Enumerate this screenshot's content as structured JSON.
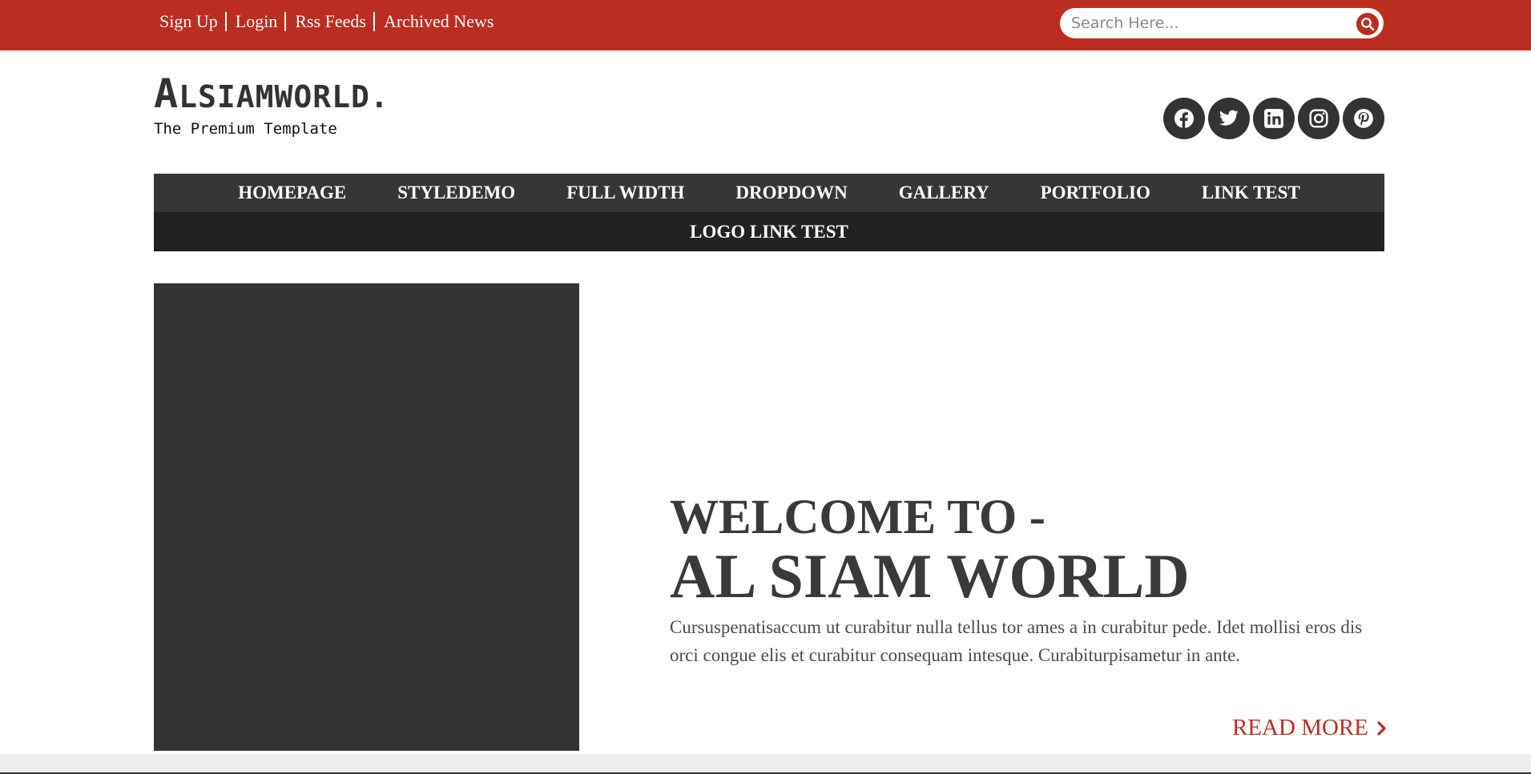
{
  "topbar": {
    "links": [
      "Sign Up",
      "Login",
      "Rss Feeds",
      "Archived News"
    ],
    "search_placeholder": "Search Here...",
    "search_icon": "search-icon"
  },
  "brand": {
    "title_cap": "A",
    "title_rest": "LSIAMWORLD.",
    "tagline": "The Premium Template"
  },
  "social": [
    "facebook-icon",
    "twitter-icon",
    "linkedin-icon",
    "instagram-icon",
    "pinterest-icon"
  ],
  "nav": {
    "items": [
      "HOMEPAGE",
      "STYLEDEMO",
      "FULL WIDTH",
      "DROPDOWN",
      "GALLERY",
      "PORTFOLIO",
      "LINK TEST",
      "LOGO LINK TEST"
    ]
  },
  "hero": {
    "line1": "WELCOME TO -",
    "line2": "AL SIAM WORLD",
    "body": "Cursuspenatisaccum ut curabitur nulla tellus tor ames a in curabitur pede. Idet mollisi eros dis orci congue elis et curabitur consequam intesque. Curabiturpisametur in ante.",
    "read_more": "READ MORE"
  },
  "colors": {
    "accent": "#bc2d21",
    "nav_bg": "#222222",
    "nav_row1": "#363636",
    "text_dark": "#3a3a3a"
  }
}
